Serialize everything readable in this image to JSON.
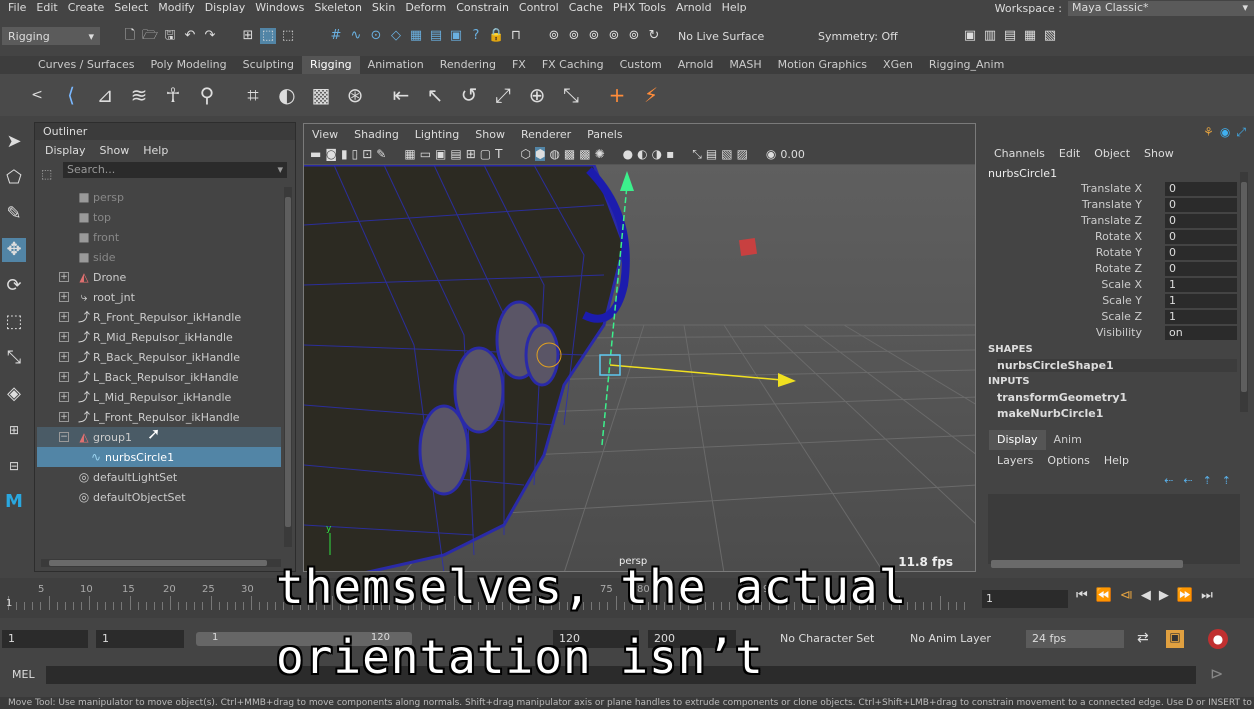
{
  "menubar": [
    "File",
    "Edit",
    "Create",
    "Select",
    "Modify",
    "Display",
    "Windows",
    "Skeleton",
    "Skin",
    "Deform",
    "Constrain",
    "Control",
    "Cache",
    "PHX Tools",
    "Arnold",
    "Help"
  ],
  "workspace": {
    "label": "Workspace :",
    "value": "Maya Classic*"
  },
  "status": {
    "menuset": "Rigging",
    "live_surface": "No Live Surface",
    "symmetry": "Symmetry: Off"
  },
  "shelf_tabs": [
    "Curves / Surfaces",
    "Poly Modeling",
    "Sculpting",
    "Rigging",
    "Animation",
    "Rendering",
    "FX",
    "FX Caching",
    "Custom",
    "Arnold",
    "MASH",
    "Motion Graphics",
    "XGen",
    "Rigging_Anim"
  ],
  "active_shelf_tab": "Rigging",
  "outliner": {
    "title": "Outliner",
    "menu": [
      "Display",
      "Show",
      "Help"
    ],
    "search_placeholder": "Search...",
    "items": [
      {
        "label": "persp",
        "icon": "camera-icon",
        "dim": true
      },
      {
        "label": "top",
        "icon": "camera-icon",
        "dim": true
      },
      {
        "label": "front",
        "icon": "camera-icon",
        "dim": true
      },
      {
        "label": "side",
        "icon": "camera-icon",
        "dim": true
      },
      {
        "label": "Drone",
        "icon": "mesh-icon",
        "expand": "+"
      },
      {
        "label": "root_jnt",
        "icon": "joint-icon",
        "expand": "+"
      },
      {
        "label": "R_Front_Repulsor_ikHandle",
        "icon": "ik-handle-icon",
        "expand": "+"
      },
      {
        "label": "R_Mid_Repulsor_ikHandle",
        "icon": "ik-handle-icon",
        "expand": "+"
      },
      {
        "label": "R_Back_Repulsor_ikHandle",
        "icon": "ik-handle-icon",
        "expand": "+"
      },
      {
        "label": "L_Back_Repulsor_ikHandle",
        "icon": "ik-handle-icon",
        "expand": "+"
      },
      {
        "label": "L_Mid_Repulsor_ikHandle",
        "icon": "ik-handle-icon",
        "expand": "+"
      },
      {
        "label": "L_Front_Repulsor_ikHandle",
        "icon": "ik-handle-icon",
        "expand": "+"
      },
      {
        "label": "group1",
        "icon": "group-icon",
        "expand": "−"
      },
      {
        "label": "nurbsCircle1",
        "icon": "nurbs-curve-icon",
        "selected": true
      },
      {
        "label": "defaultLightSet",
        "icon": "set-icon"
      },
      {
        "label": "defaultObjectSet",
        "icon": "set-icon"
      }
    ]
  },
  "viewport": {
    "menu": [
      "View",
      "Shading",
      "Lighting",
      "Show",
      "Renderer",
      "Panels"
    ],
    "camera_label": "persp",
    "fps": "11.8 fps",
    "field_value": "0.00"
  },
  "channel_box": {
    "menu": [
      "Channels",
      "Edit",
      "Object",
      "Show"
    ],
    "object": "nurbsCircle1",
    "attributes": [
      {
        "name": "Translate X",
        "value": "0"
      },
      {
        "name": "Translate Y",
        "value": "0"
      },
      {
        "name": "Translate Z",
        "value": "0"
      },
      {
        "name": "Rotate X",
        "value": "0"
      },
      {
        "name": "Rotate Y",
        "value": "0"
      },
      {
        "name": "Rotate Z",
        "value": "0"
      },
      {
        "name": "Scale X",
        "value": "1"
      },
      {
        "name": "Scale Y",
        "value": "1"
      },
      {
        "name": "Scale Z",
        "value": "1"
      },
      {
        "name": "Visibility",
        "value": "on"
      }
    ],
    "shapes_header": "SHAPES",
    "shape": "nurbsCircleShape1",
    "inputs_header": "INPUTS",
    "inputs": [
      "transformGeometry1",
      "makeNurbCircle1"
    ]
  },
  "layer_editor": {
    "tabs": [
      "Display",
      "Anim"
    ],
    "active_tab": "Display",
    "menu": [
      "Layers",
      "Options",
      "Help"
    ]
  },
  "timeline": {
    "ticks": [
      "5",
      "10",
      "15",
      "20",
      "25",
      "30",
      "75",
      "80",
      "95"
    ],
    "start_marker": "1",
    "current_frame": "1"
  },
  "range": {
    "start": "1",
    "playback_start": "1",
    "slider_start": "1",
    "slider_end": "120",
    "playback_end": "120",
    "end": "200",
    "character_set": "No Character Set",
    "anim_layer": "No Anim Layer",
    "fps": "24 fps"
  },
  "command_line": {
    "label": "MEL"
  },
  "help_line": "Move Tool: Use manipulator to move object(s). Ctrl+MMB+drag to move components along normals. Shift+drag manipulator axis or plane handles to extrude components or clone objects. Ctrl+Shift+LMB+drag to constrain movement to a connected edge. Use D or INSERT to chan",
  "subtitles": [
    "themselves, the actual",
    "orientation isn’t"
  ]
}
